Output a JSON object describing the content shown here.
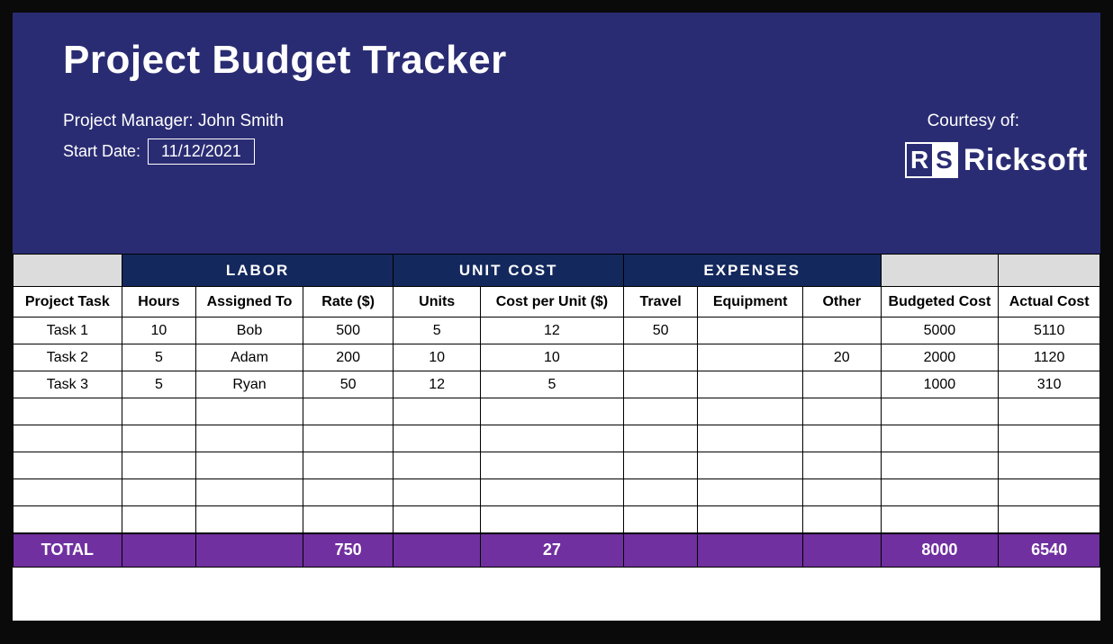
{
  "title": "Project Budget Tracker",
  "project_manager_label": "Project Manager:",
  "project_manager": "John Smith",
  "start_date_label": "Start Date:",
  "start_date": "11/12/2021",
  "courtesy_label": "Courtesy of:",
  "brand": "Ricksoft",
  "group_headers": {
    "labor": "LABOR",
    "unit_cost": "UNIT COST",
    "expenses": "EXPENSES"
  },
  "columns": {
    "task": "Project Task",
    "hours": "Hours",
    "assigned": "Assigned To",
    "rate": "Rate ($)",
    "units": "Units",
    "cpu": "Cost per Unit ($)",
    "travel": "Travel",
    "equipment": "Equipment",
    "other": "Other",
    "budgeted": "Budgeted Cost",
    "actual": "Actual Cost"
  },
  "rows": [
    {
      "task": "Task 1",
      "hours": "10",
      "assigned": "Bob",
      "rate": "500",
      "units": "5",
      "cpu": "12",
      "travel": "50",
      "equipment": "",
      "other": "",
      "budgeted": "5000",
      "actual": "5110"
    },
    {
      "task": "Task 2",
      "hours": "5",
      "assigned": "Adam",
      "rate": "200",
      "units": "10",
      "cpu": "10",
      "travel": "",
      "equipment": "",
      "other": "20",
      "budgeted": "2000",
      "actual": "1120"
    },
    {
      "task": "Task 3",
      "hours": "5",
      "assigned": "Ryan",
      "rate": "50",
      "units": "12",
      "cpu": "5",
      "travel": "",
      "equipment": "",
      "other": "",
      "budgeted": "1000",
      "actual": "310"
    },
    {
      "task": "",
      "hours": "",
      "assigned": "",
      "rate": "",
      "units": "",
      "cpu": "",
      "travel": "",
      "equipment": "",
      "other": "",
      "budgeted": "",
      "actual": ""
    },
    {
      "task": "",
      "hours": "",
      "assigned": "",
      "rate": "",
      "units": "",
      "cpu": "",
      "travel": "",
      "equipment": "",
      "other": "",
      "budgeted": "",
      "actual": ""
    },
    {
      "task": "",
      "hours": "",
      "assigned": "",
      "rate": "",
      "units": "",
      "cpu": "",
      "travel": "",
      "equipment": "",
      "other": "",
      "budgeted": "",
      "actual": ""
    },
    {
      "task": "",
      "hours": "",
      "assigned": "",
      "rate": "",
      "units": "",
      "cpu": "",
      "travel": "",
      "equipment": "",
      "other": "",
      "budgeted": "",
      "actual": ""
    },
    {
      "task": "",
      "hours": "",
      "assigned": "",
      "rate": "",
      "units": "",
      "cpu": "",
      "travel": "",
      "equipment": "",
      "other": "",
      "budgeted": "",
      "actual": ""
    }
  ],
  "total": {
    "label": "TOTAL",
    "hours": "",
    "assigned": "",
    "rate": "750",
    "units": "",
    "cpu": "27",
    "travel": "",
    "equipment": "",
    "other": "",
    "budgeted": "8000",
    "actual": "6540"
  }
}
